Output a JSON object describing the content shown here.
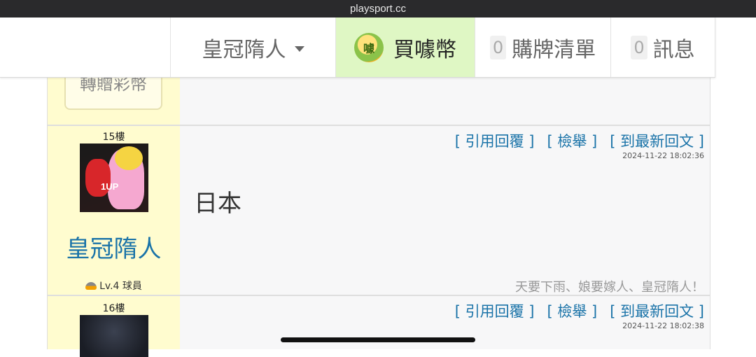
{
  "browser": {
    "url": "playsport.cc"
  },
  "nav": {
    "user_label": "皇冠隋人",
    "coin_label": "買噱幣",
    "coin_icon_char": "噱",
    "cart_count": "0",
    "cart_label": "購牌清單",
    "msg_count": "0",
    "msg_label": "訊息"
  },
  "gift_button": "轉贈彩幣",
  "posts": [
    {
      "floor": "15樓",
      "username": "皇冠隋人",
      "level": "Lv.4 球員",
      "actions": {
        "quote": "[ 引用回覆 ]",
        "report": "[ 檢舉 ]",
        "latest": "[ 到最新回文 ]"
      },
      "timestamp": "2024-11-22 18:02:36",
      "avatar_badge": "1UP",
      "content": "日本",
      "signature": "天要下雨、娘要嫁人、皇冠隋人！"
    },
    {
      "floor": "16樓",
      "actions": {
        "quote": "[ 引用回覆 ]",
        "report": "[ 檢舉 ]",
        "latest": "[ 到最新回文 ]"
      },
      "timestamp": "2024-11-22 18:02:38"
    }
  ]
}
